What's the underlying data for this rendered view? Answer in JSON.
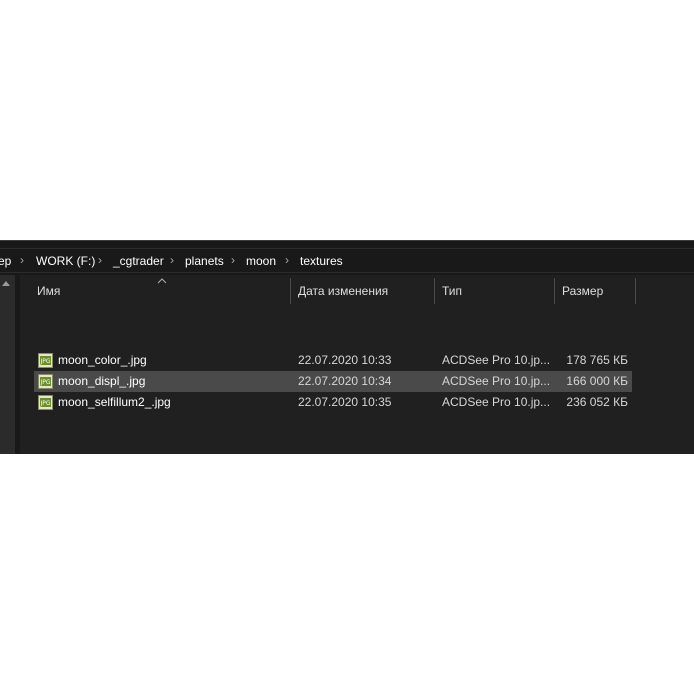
{
  "breadcrumb": {
    "segments": [
      "ер",
      "WORK (F:)",
      "_cgtrader",
      "planets",
      "moon",
      "textures"
    ]
  },
  "columns": {
    "name": "Имя",
    "date": "Дата изменения",
    "type": "Тип",
    "size": "Размер"
  },
  "files": [
    {
      "name": "moon_color_.jpg",
      "date": "22.07.2020 10:33",
      "type": "ACDSee Pro 10.jp...",
      "size": "178 765 КБ",
      "selected": false
    },
    {
      "name": "moon_displ_.jpg",
      "date": "22.07.2020 10:34",
      "type": "ACDSee Pro 10.jp...",
      "size": "166 000 КБ",
      "selected": true
    },
    {
      "name": "moon_selfillum2_.jpg",
      "date": "22.07.2020 10:35",
      "type": "ACDSee Pro 10.jp...",
      "size": "236 052 КБ",
      "selected": false
    }
  ],
  "icons": {
    "file": "jpg-file-icon",
    "separator": "chevron-right-icon",
    "sort": "sort-up-icon",
    "nav": "scroll-up-arrow-icon"
  },
  "colors": {
    "window_bg": "#191919",
    "list_bg": "#202020",
    "selected_row": "#4a4a4a",
    "text": "#ffffff"
  }
}
